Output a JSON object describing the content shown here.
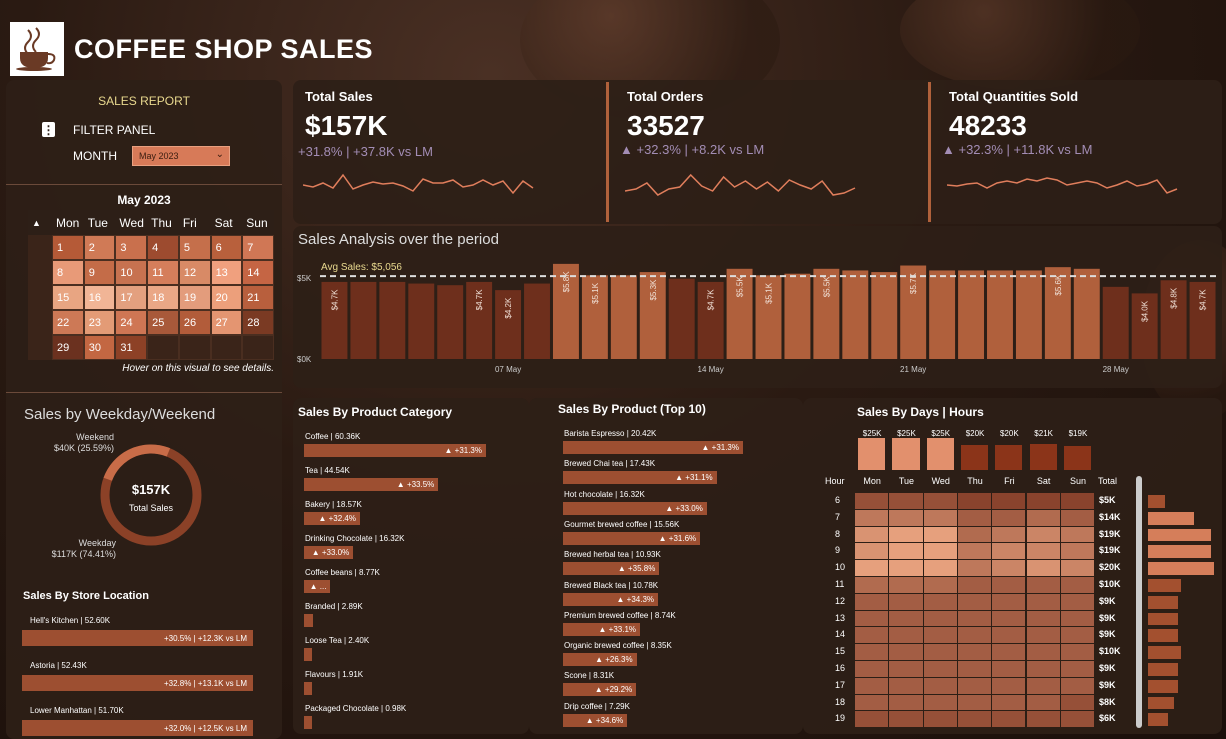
{
  "app": {
    "title": "COFFEE SHOP SALES"
  },
  "filter": {
    "sales_report": "SALES REPORT",
    "filter_panel": "FILTER PANEL",
    "month_label": "MONTH",
    "month_value": "May 2023"
  },
  "calendar": {
    "title": "May 2023",
    "days": [
      "Mon",
      "Tue",
      "Wed",
      "Thu",
      "Fri",
      "Sat",
      "Sun"
    ],
    "weeks": [
      [
        1,
        2,
        3,
        4,
        5,
        6,
        7
      ],
      [
        8,
        9,
        10,
        11,
        12,
        13,
        14
      ],
      [
        15,
        16,
        17,
        18,
        19,
        20,
        21
      ],
      [
        22,
        23,
        24,
        25,
        26,
        27,
        28
      ],
      [
        29,
        30,
        31,
        null,
        null,
        null,
        null
      ]
    ],
    "hover_hint": "Hover on this visual to see details."
  },
  "weekday_weekend": {
    "title": "Sales by Weekday/Weekend",
    "weekend_label": "Weekend",
    "weekend_value": "$40K (25.59%)",
    "weekday_label": "Weekday",
    "weekday_value": "$117K (74.41%)",
    "center_value": "$157K",
    "center_label": "Total Sales",
    "weekend_share": 0.2559
  },
  "store": {
    "title": "Sales By Store Location",
    "items": [
      {
        "label": "Hell's Kitchen | 52.60K",
        "delta": "+30.5% | +12.3K vs LM"
      },
      {
        "label": "Astoria | 52.43K",
        "delta": "+32.8% | +13.1K vs LM"
      },
      {
        "label": "Lower Manhattan | 51.70K",
        "delta": "+32.0% | +12.5K vs LM"
      }
    ]
  },
  "kpis": [
    {
      "title": "Total Sales",
      "value": "$157K",
      "delta": "+31.8% | +37.8K vs LM"
    },
    {
      "title": "Total Orders",
      "value": "33527",
      "delta": "▲ +32.3% | +8.2K vs LM"
    },
    {
      "title": "Total Quantities Sold",
      "value": "48233",
      "delta": "▲ +32.3% | +11.8K vs LM"
    }
  ],
  "analysis": {
    "title": "Sales Analysis over the period",
    "avg_label": "Avg Sales: $5,056",
    "y_top": "$5K",
    "y_bottom": "$0K",
    "x_labels": [
      "07 May",
      "14 May",
      "21 May",
      "28 May"
    ]
  },
  "chart_data": {
    "type": "bar",
    "title": "Sales Analysis over the period",
    "categories": [
      "1",
      "2",
      "3",
      "4",
      "5",
      "6",
      "7",
      "8",
      "9",
      "10",
      "11",
      "12",
      "13",
      "14",
      "15",
      "16",
      "17",
      "18",
      "19",
      "20",
      "21",
      "22",
      "23",
      "24",
      "25",
      "26",
      "27",
      "28",
      "29",
      "30",
      "31"
    ],
    "values": [
      4.7,
      4.7,
      4.7,
      4.6,
      4.5,
      4.7,
      4.2,
      4.6,
      5.8,
      5.1,
      5.1,
      5.3,
      4.9,
      4.7,
      5.5,
      5.1,
      5.2,
      5.5,
      5.4,
      5.3,
      5.7,
      5.4,
      5.4,
      5.4,
      5.4,
      5.6,
      5.5,
      4.4,
      4.0,
      4.8,
      4.7
    ],
    "data_labels": [
      "$4.7K",
      "",
      "",
      "",
      "",
      "$4.7K",
      "$4.2K",
      "",
      "$5.8K",
      "$5.1K",
      "",
      "$5.3K",
      "",
      "$4.7K",
      "$5.5K",
      "$5.1K",
      "",
      "$5.5K",
      "",
      "",
      "$5.7K",
      "",
      "",
      "",
      "",
      "$5.6K",
      "",
      "",
      "$4.0K",
      "$4.8K",
      "$4.7K"
    ],
    "avg": 5.056,
    "ylabel": "",
    "ylim": [
      0,
      6
    ]
  },
  "category": {
    "title": "Sales By Product Category",
    "items": [
      {
        "label": "Coffee | 60.36K",
        "delta": "▲ +31.3%",
        "value": 60.36
      },
      {
        "label": "Tea | 44.54K",
        "delta": "▲ +33.5%",
        "value": 44.54
      },
      {
        "label": "Bakery | 18.57K",
        "delta": "▲ +32.4%",
        "value": 18.57
      },
      {
        "label": "Drinking Chocolate | 16.32K",
        "delta": "▲ +33.0%",
        "value": 16.32
      },
      {
        "label": "Coffee beans | 8.77K",
        "delta": "▲ ...",
        "value": 8.77
      },
      {
        "label": "Branded | 2.89K",
        "delta": "",
        "value": 2.89
      },
      {
        "label": "Loose Tea | 2.40K",
        "delta": "",
        "value": 2.4
      },
      {
        "label": "Flavours | 1.91K",
        "delta": "",
        "value": 1.91
      },
      {
        "label": "Packaged Chocolate | 0.98K",
        "delta": "",
        "value": 0.98
      }
    ]
  },
  "products": {
    "title": "Sales By Product (Top 10)",
    "items": [
      {
        "label": "Barista Espresso | 20.42K",
        "delta": "▲ +31.3%",
        "value": 20.42
      },
      {
        "label": "Brewed Chai tea | 17.43K",
        "delta": "▲ +31.1%",
        "value": 17.43
      },
      {
        "label": "Hot chocolate | 16.32K",
        "delta": "▲ +33.0%",
        "value": 16.32
      },
      {
        "label": "Gourmet brewed coffee | 15.56K",
        "delta": "▲ +31.6%",
        "value": 15.56
      },
      {
        "label": "Brewed herbal tea | 10.93K",
        "delta": "▲ +35.8%",
        "value": 10.93
      },
      {
        "label": "Brewed Black tea | 10.78K",
        "delta": "▲ +34.3%",
        "value": 10.78
      },
      {
        "label": "Premium brewed coffee | 8.74K",
        "delta": "▲ +33.1%",
        "value": 8.74
      },
      {
        "label": "Organic brewed coffee | 8.35K",
        "delta": "▲ +26.3%",
        "value": 8.35
      },
      {
        "label": "Scone | 8.31K",
        "delta": "▲ +29.2%",
        "value": 8.31
      },
      {
        "label": "Drip coffee | 7.29K",
        "delta": "▲ +34.6%",
        "value": 7.29
      }
    ]
  },
  "heatmap": {
    "title": "Sales By Days | Hours",
    "day_totals": [
      "$25K",
      "$25K",
      "$25K",
      "$20K",
      "$20K",
      "$21K",
      "$19K"
    ],
    "hour_label": "Hour",
    "total_label": "Total",
    "days": [
      "Mon",
      "Tue",
      "Wed",
      "Thu",
      "Fri",
      "Sat",
      "Sun"
    ],
    "hours": [
      "6",
      "7",
      "8",
      "9",
      "10",
      "11",
      "12",
      "13",
      "14",
      "15",
      "16",
      "17",
      "18",
      "19"
    ],
    "hour_totals": [
      "$5K",
      "$14K",
      "$19K",
      "$19K",
      "$20K",
      "$10K",
      "$9K",
      "$9K",
      "$9K",
      "$10K",
      "$9K",
      "$9K",
      "$8K",
      "$6K"
    ]
  }
}
